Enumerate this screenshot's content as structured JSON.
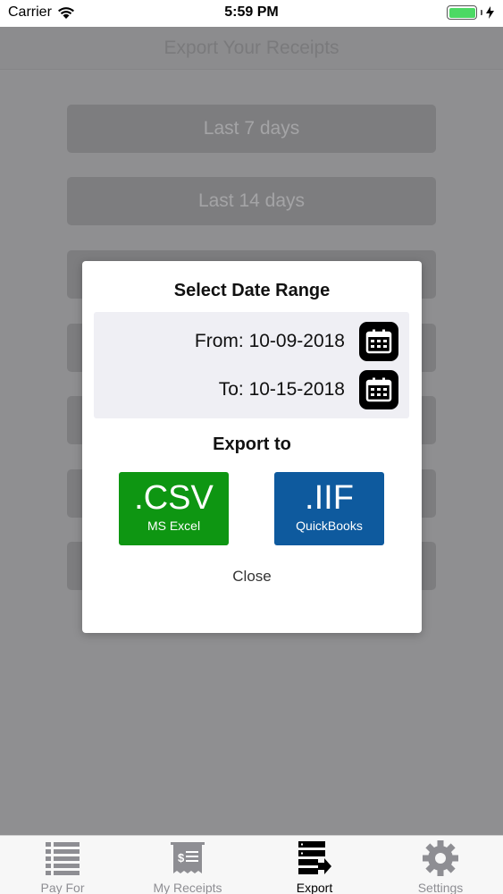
{
  "status_bar": {
    "carrier": "Carrier",
    "time": "5:59 PM",
    "battery_color": "#4cd964"
  },
  "nav": {
    "title": "Export Your Receipts"
  },
  "background_options": [
    {
      "label": "Last 7 days"
    },
    {
      "label": "Last 14 days"
    }
  ],
  "modal": {
    "title": "Select Date Range",
    "from_label": "From: 10-09-2018",
    "to_label": "To: 10-15-2018",
    "export_title": "Export to",
    "csv": {
      "main": ".CSV",
      "sub": "MS Excel",
      "color": "#0e9612"
    },
    "iif": {
      "main": ".IIF",
      "sub": "QuickBooks",
      "color": "#0e5a9e"
    },
    "close": "Close"
  },
  "tabs": [
    {
      "label": "Pay For",
      "icon": "list-icon"
    },
    {
      "label": "My Receipts",
      "icon": "receipt-icon"
    },
    {
      "label": "Export",
      "icon": "export-icon",
      "active": true
    },
    {
      "label": "Settings",
      "icon": "gear-icon"
    }
  ]
}
